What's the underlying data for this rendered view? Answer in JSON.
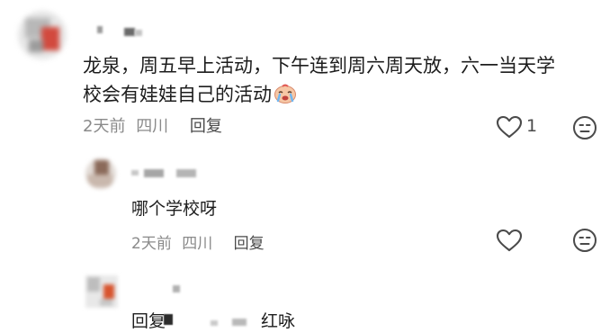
{
  "main_comment": {
    "text_line1": "龙泉，周五早上活动，下午连到周六周天放，六一当天学",
    "text_line2": "校会有娃娃自己的活动",
    "time": "2天前",
    "location": "四川",
    "reply_label": "回复",
    "like_count": "1",
    "icons": {
      "emoji": "crying-face-icon",
      "like": "heart-outline-icon",
      "dislike": "unhappy-face-icon"
    }
  },
  "reply_1": {
    "text": "哪个学校呀",
    "time": "2天前",
    "location": "四川",
    "reply_label": "回复",
    "icons": {
      "like": "heart-outline-icon",
      "dislike": "unhappy-face-icon"
    }
  },
  "reply_2": {
    "prefix": "回复",
    "suffix": "红咏"
  },
  "colors": {
    "text_primary": "#1d1d1d",
    "text_secondary": "#8a8a8a",
    "icon_stroke": "#4a4a4a",
    "background": "#ffffff"
  }
}
